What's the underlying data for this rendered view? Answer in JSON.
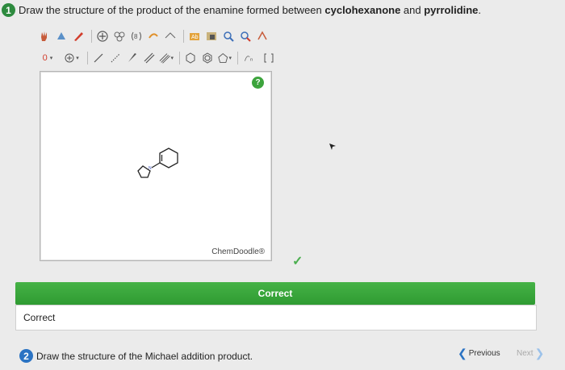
{
  "question1": {
    "number": "1",
    "text_prefix": "Draw the structure of the product of the enamine formed between ",
    "bold1": "cyclohexanone",
    "mid": " and ",
    "bold2": "pyrrolidine",
    "suffix": "."
  },
  "toolbar": {
    "charge_value": "0",
    "icons_row1": [
      "hand-icon",
      "erase-icon",
      "pencil-icon",
      "add-atom-icon",
      "ring-icon",
      "bracket-icon",
      "lasso-icon",
      "clean-icon",
      "template-icon",
      "zoom-in-icon",
      "zoom-out-icon",
      "atom-properties-icon"
    ],
    "icons_row2": [
      "charge-select",
      "plus-charge-icon",
      "single-bond-icon",
      "dashed-bond-icon",
      "wedge-bond-icon",
      "double-bond-icon",
      "triple-bond-icon",
      "benzene-ring-icon",
      "cyclohexane-ring-icon",
      "cyclopentane-ring-icon",
      "curve-icon",
      "bracket-icon"
    ]
  },
  "canvas": {
    "help_label": "?",
    "watermark": "ChemDoodle®"
  },
  "status": {
    "checkmark": "✓",
    "feedback_title": "Correct",
    "feedback_text": "Correct"
  },
  "question2": {
    "number": "2",
    "text": "Draw the structure of the Michael addition product."
  },
  "navigation": {
    "previous": "Previous",
    "next": "Next"
  }
}
